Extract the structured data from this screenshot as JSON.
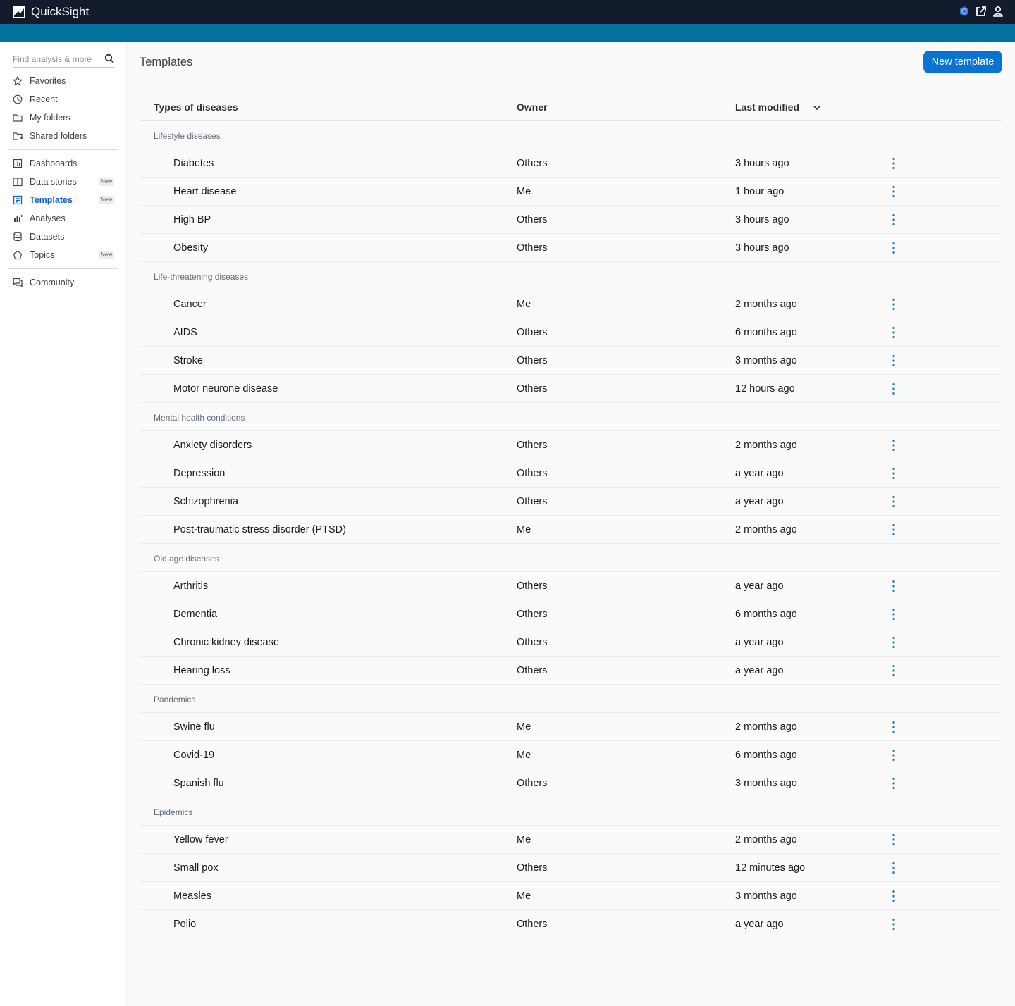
{
  "app": {
    "title": "QuickSight"
  },
  "colors": {
    "topbar": "#121c2c",
    "stripe": "#03719c",
    "primary": "#0972d3",
    "active_nav": "#0a5ec9"
  },
  "topbar_icons": [
    "aws-hexagon-icon",
    "external-link-icon",
    "user-icon"
  ],
  "sidebar": {
    "search_placeholder": "Find analysis & more",
    "items": [
      {
        "label": "Favorites",
        "icon": "star-icon"
      },
      {
        "label": "Recent",
        "icon": "clock-icon"
      },
      {
        "label": "My folders",
        "icon": "folder-icon"
      },
      {
        "label": "Shared folders",
        "icon": "shared-folder-icon"
      },
      {
        "label": "Dashboards",
        "icon": "dashboard-icon"
      },
      {
        "label": "Data stories",
        "icon": "book-icon",
        "badge": "New"
      },
      {
        "label": "Templates",
        "icon": "template-icon",
        "badge": "New",
        "active": true
      },
      {
        "label": "Analyses",
        "icon": "bar-chart-icon"
      },
      {
        "label": "Datasets",
        "icon": "database-icon"
      },
      {
        "label": "Topics",
        "icon": "topic-icon",
        "badge": "New"
      },
      {
        "label": "Community",
        "icon": "chat-icon"
      }
    ]
  },
  "main": {
    "title": "Templates",
    "new_button": "New template",
    "columns": {
      "name": "Types of diseases",
      "owner": "Owner",
      "modified": "Last modified"
    },
    "sort": {
      "column": "Last modified",
      "direction": "descending"
    },
    "groups": [
      {
        "name": "Lifestyle diseases",
        "rows": [
          {
            "name": "Diabetes",
            "owner": "Others",
            "modified": "3 hours ago"
          },
          {
            "name": "Heart disease",
            "owner": "Me",
            "modified": "1 hour ago"
          },
          {
            "name": "High BP",
            "owner": "Others",
            "modified": "3 hours ago"
          },
          {
            "name": "Obesity",
            "owner": "Others",
            "modified": "3 hours ago"
          }
        ]
      },
      {
        "name": "Life-threatening diseases",
        "rows": [
          {
            "name": "Cancer",
            "owner": "Me",
            "modified": "2 months ago"
          },
          {
            "name": "AIDS",
            "owner": "Others",
            "modified": "6 months ago"
          },
          {
            "name": "Stroke",
            "owner": "Others",
            "modified": "3 months ago"
          },
          {
            "name": "Motor neurone disease",
            "owner": "Others",
            "modified": "12 hours ago"
          }
        ]
      },
      {
        "name": "Mental health conditions",
        "rows": [
          {
            "name": "Anxiety disorders",
            "owner": "Others",
            "modified": "2 months ago"
          },
          {
            "name": "Depression",
            "owner": "Others",
            "modified": "a year ago"
          },
          {
            "name": "Schizophrenia",
            "owner": "Others",
            "modified": "a year ago"
          },
          {
            "name": "Post-traumatic stress disorder (PTSD)",
            "owner": "Me",
            "modified": "2 months ago"
          }
        ]
      },
      {
        "name": "Old age diseases",
        "rows": [
          {
            "name": "Arthritis",
            "owner": "Others",
            "modified": "a year ago"
          },
          {
            "name": "Dementia",
            "owner": "Others",
            "modified": "6 months ago"
          },
          {
            "name": "Chronic kidney disease",
            "owner": "Others",
            "modified": "a year ago"
          },
          {
            "name": "Hearing loss",
            "owner": "Others",
            "modified": "a year ago"
          }
        ]
      },
      {
        "name": "Pandemics",
        "rows": [
          {
            "name": "Swine flu",
            "owner": "Me",
            "modified": "2 months ago"
          },
          {
            "name": "Covid-19",
            "owner": "Me",
            "modified": "6 months ago"
          },
          {
            "name": "Spanish flu",
            "owner": "Others",
            "modified": "3 months ago"
          }
        ]
      },
      {
        "name": "Epidemics",
        "rows": [
          {
            "name": "Yellow fever",
            "owner": "Me",
            "modified": "2 months ago"
          },
          {
            "name": "Small pox",
            "owner": "Others",
            "modified": "12 minutes ago"
          },
          {
            "name": "Measles",
            "owner": "Me",
            "modified": "3 months ago"
          },
          {
            "name": "Polio",
            "owner": "Others",
            "modified": "a year ago"
          }
        ]
      }
    ]
  }
}
